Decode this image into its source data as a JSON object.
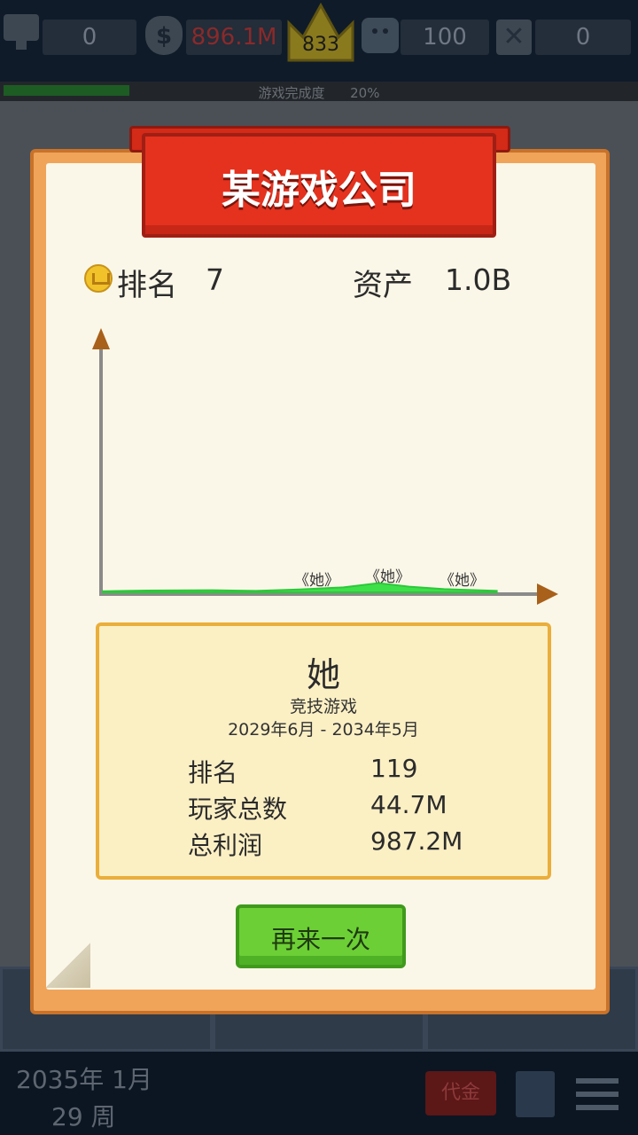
{
  "topbar": {
    "stat1": "0",
    "money": "896.1M",
    "crown": "833",
    "fans": "100",
    "stat5": "0"
  },
  "progress": {
    "label": "游戏完成度",
    "percent": "20%",
    "fraction": 0.2
  },
  "modal": {
    "title": "某游戏公司",
    "rank_label": "排名",
    "rank_value": "7",
    "assets_label": "资产",
    "assets_value": "1.0B"
  },
  "chart_data": {
    "type": "area",
    "point_labels": [
      "《她》",
      "《她》",
      "《她》"
    ],
    "series": [
      {
        "x": [
          0,
          0.1,
          0.25,
          0.35,
          0.45,
          0.55,
          0.63,
          0.7,
          0.78,
          0.9
        ],
        "y": [
          0.3,
          0.5,
          0.6,
          0.4,
          0.8,
          1.4,
          2.6,
          1.6,
          0.9,
          0.4
        ]
      }
    ]
  },
  "game": {
    "title": "她",
    "genre": "竞技游戏",
    "period": "2029年6月 - 2034年5月",
    "stats": [
      {
        "label": "排名",
        "value": "119"
      },
      {
        "label": "玩家总数",
        "value": "44.7M"
      },
      {
        "label": "总利润",
        "value": "987.2M"
      }
    ]
  },
  "retry_label": "再来一次",
  "bottombar": {
    "date_line1": "2035年 1月",
    "date_line2": "29 周",
    "invest_label": "代金"
  },
  "colors": {
    "banner": "#e4321f",
    "card_border": "#f0a45a",
    "retry": "#6ccf36",
    "chart_fill": "#3ee04a"
  }
}
